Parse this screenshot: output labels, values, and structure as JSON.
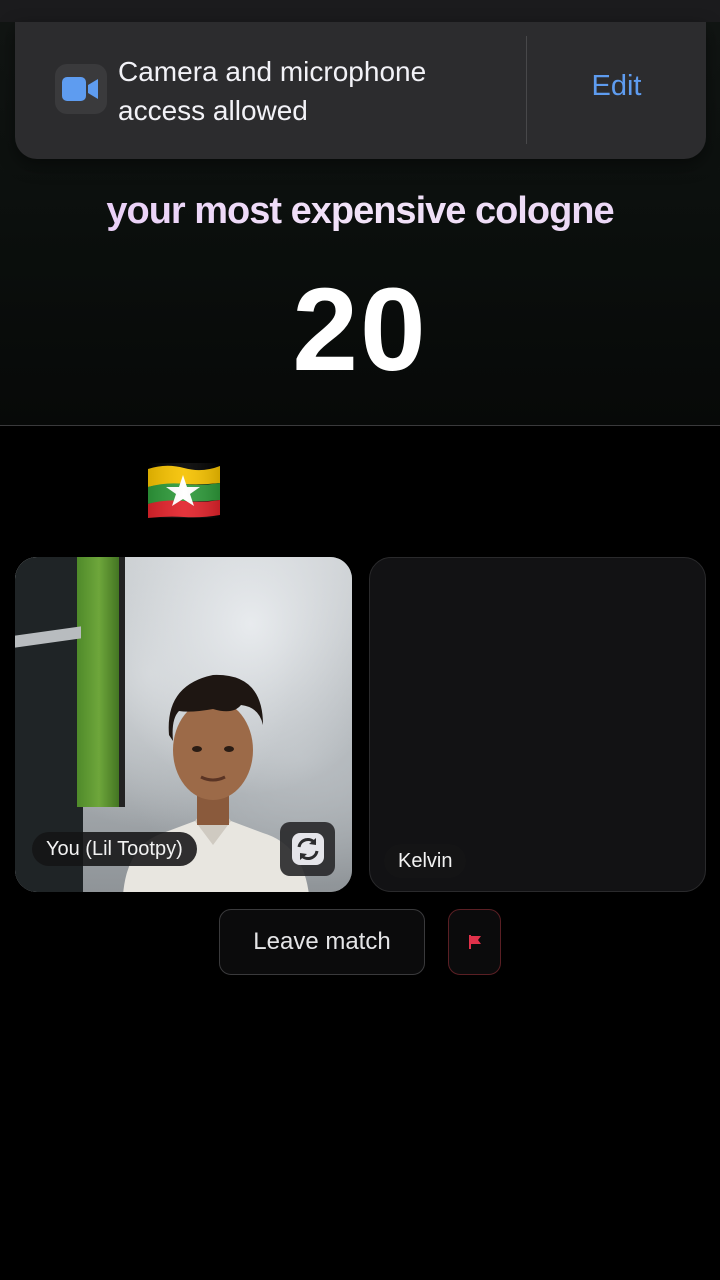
{
  "permission_toast": {
    "message": "Camera and microphone access allowed",
    "action_label": "Edit",
    "icon": "video-camera-icon"
  },
  "game": {
    "prompt": "your most expensive cologne",
    "timer": "20"
  },
  "flag": {
    "icon": "myanmar-flag-icon"
  },
  "participants": [
    {
      "name": "You (Lil Tootpy)",
      "video": "camera-feed"
    },
    {
      "name": "Kelvin",
      "video": "none"
    }
  ],
  "controls": {
    "leave_label": "Leave match",
    "report_icon": "red-flag-icon",
    "flip_icon": "camera-flip-icon"
  },
  "colors": {
    "background": "#000000",
    "toast_bg": "#2c2c2e",
    "link_blue": "#5e9cf0",
    "report_red": "#e0314a",
    "prompt_tint": "#ead6f7"
  }
}
